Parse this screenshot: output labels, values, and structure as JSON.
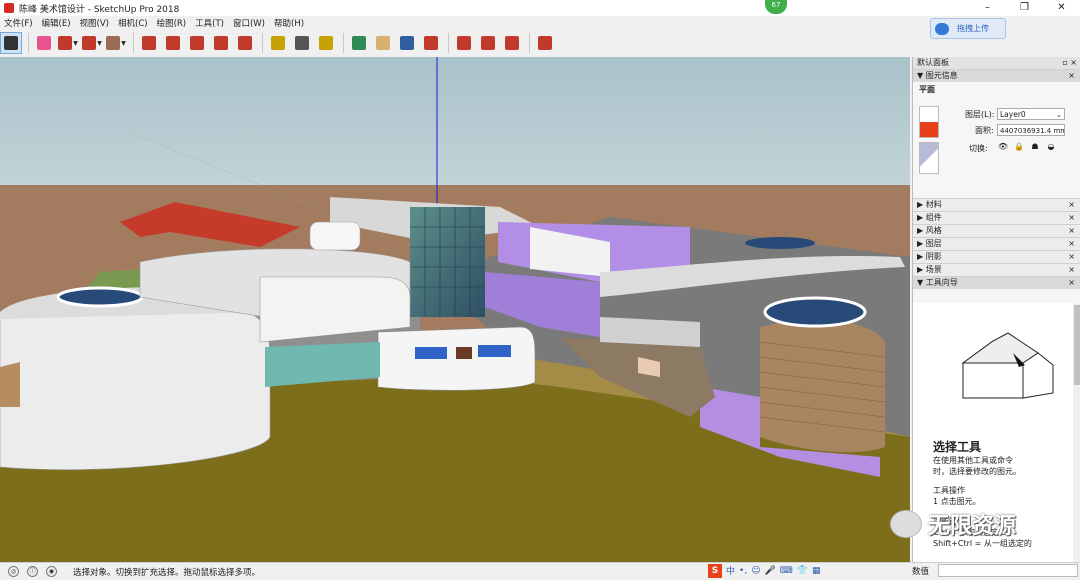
{
  "window": {
    "title": "陈峰 美术馆设计 - SketchUp Pro 2018",
    "minimize": "–",
    "restore": "❐",
    "close": "✕",
    "badge": "67",
    "upload": "拖拽上传"
  },
  "menu": [
    "文件(F)",
    "编辑(E)",
    "视图(V)",
    "相机(C)",
    "绘图(R)",
    "工具(T)",
    "窗口(W)",
    "帮助(H)"
  ],
  "toolbar": [
    {
      "icon": "select-arrow-icon",
      "color": "#333333"
    },
    {
      "icon": "eraser-icon",
      "color": "#e8528f"
    },
    {
      "icon": "pencil-icon",
      "color": "#c0392b"
    },
    {
      "icon": "arc-icon",
      "color": "#c0392b"
    },
    {
      "icon": "rectangle-icon",
      "color": "#9a6b52"
    },
    {
      "icon": "push-pull-icon",
      "color": "#c23a2b"
    },
    {
      "icon": "follow-me-icon",
      "color": "#c23a2b"
    },
    {
      "icon": "move-icon",
      "color": "#c23a2b"
    },
    {
      "icon": "rotate-icon",
      "color": "#c23a2b"
    },
    {
      "icon": "scale-icon",
      "color": "#c23a2b"
    },
    {
      "icon": "tape-measure-icon",
      "color": "#c8a200"
    },
    {
      "icon": "text-icon",
      "color": "#555555"
    },
    {
      "icon": "paint-bucket-icon",
      "color": "#c8a200"
    },
    {
      "icon": "orbit-icon",
      "color": "#2e8b57"
    },
    {
      "icon": "pan-icon",
      "color": "#d8b070"
    },
    {
      "icon": "zoom-icon",
      "color": "#2f5fa0"
    },
    {
      "icon": "zoom-extents-icon",
      "color": "#c23a2b"
    },
    {
      "icon": "warehouse-icon",
      "color": "#c23a2b"
    },
    {
      "icon": "extension-warehouse-icon",
      "color": "#c23a2b"
    },
    {
      "icon": "layout-icon",
      "color": "#c23a2b"
    },
    {
      "icon": "ruby-icon",
      "color": "#c0392b"
    }
  ],
  "panel": {
    "title": "默认面板",
    "entity_info": {
      "header": "图元信息",
      "type": "平面",
      "layer_label": "图层(L):",
      "layer_value": "Layer0",
      "area_label": "面积:",
      "area_value": "4407036931.4 mm²",
      "toggle_label": "切换:"
    },
    "sections": [
      "材料",
      "组件",
      "风格",
      "图层",
      "阴影",
      "场景"
    ],
    "guide": {
      "header": "工具向导",
      "title": "选择工具",
      "p1": "在使用其他工具或命令\n时，选择要修改的图元。",
      "p2h": "工具操作",
      "p2": "1 点击图元。",
      "p3h": "功能键",
      "p3": "Ctrl = 添加到选定...\nShift+Ctrl = 从一组选定的"
    }
  },
  "status": {
    "text": "选择对象。切换到扩充选择。拖动鼠标选择多项。",
    "measure_label": "数值",
    "measure_value": ""
  },
  "ime": {
    "logo": "S",
    "mode": "中"
  },
  "watermark": "无限资源"
}
